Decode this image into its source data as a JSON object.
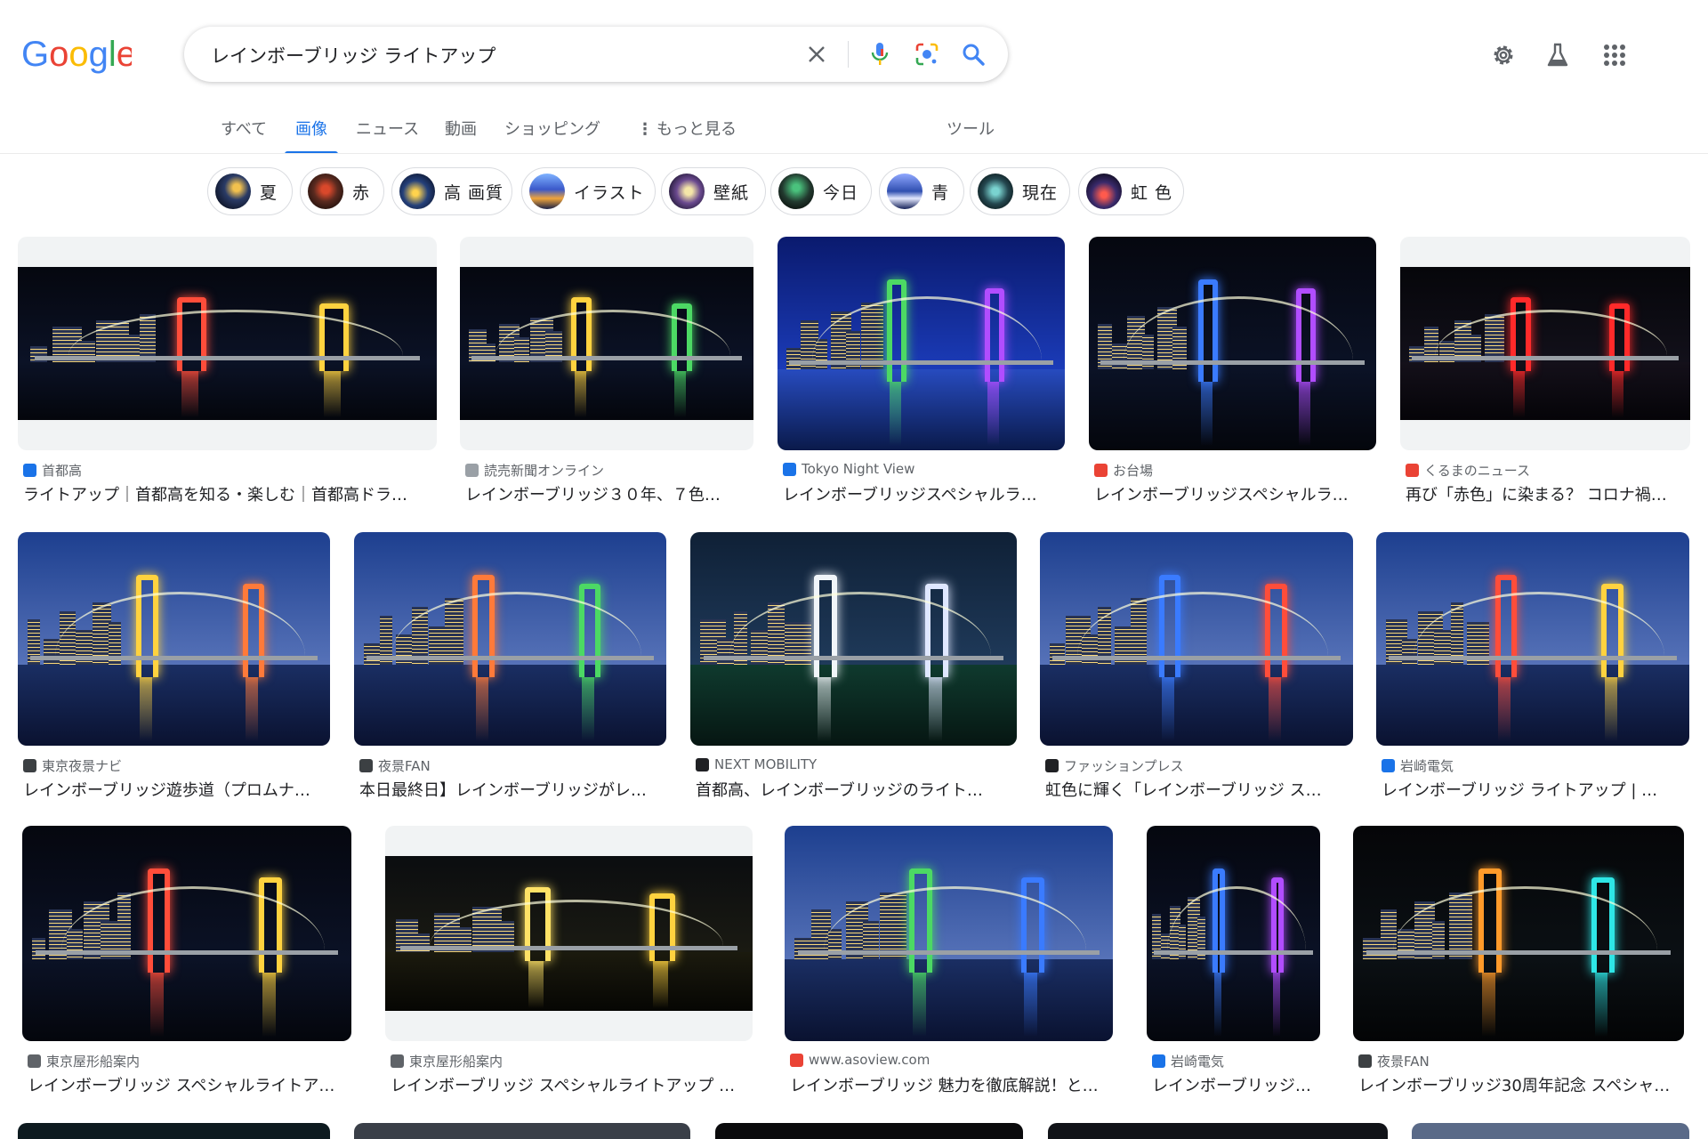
{
  "search": {
    "query": "レインボーブリッジ ライトアップ"
  },
  "brand": {
    "logo_letters": [
      "G",
      "o",
      "o",
      "g",
      "l",
      "e"
    ]
  },
  "tabs": [
    {
      "label": "すべて"
    },
    {
      "label": "画像"
    },
    {
      "label": "ニュース"
    },
    {
      "label": "動画"
    },
    {
      "label": "ショッピング"
    },
    {
      "label": "もっと見る"
    },
    {
      "label": "ツール"
    }
  ],
  "chips": [
    {
      "label": "夏"
    },
    {
      "label": "赤"
    },
    {
      "label": "高 画質"
    },
    {
      "label": "イラスト"
    },
    {
      "label": "壁紙"
    },
    {
      "label": "今日"
    },
    {
      "label": "青"
    },
    {
      "label": "現在"
    },
    {
      "label": "虹 色"
    }
  ],
  "results": [
    {
      "source": "首都高",
      "title": "ライトアップ｜首都高を知る・楽しむ｜首都高ドラ…",
      "fav_color": "#1a73e8",
      "scheme": "rainbow"
    },
    {
      "source": "読売新聞オンライン",
      "title": "レインボーブリッジ３０年、７色…",
      "fav_color": "#9aa0a6",
      "scheme": "rainbow"
    },
    {
      "source": "Tokyo Night View",
      "title": "レインボーブリッジスペシャルラ…",
      "fav_color": "#1a73e8",
      "scheme": "vivid"
    },
    {
      "source": "お台場",
      "title": "レインボーブリッジスペシャルラ…",
      "fav_color": "#ea4335",
      "scheme": "rainbow"
    },
    {
      "source": "くるまのニュース",
      "title": "再び「赤色」に染まる？ コロナ禍…",
      "fav_color": "#ea4335",
      "scheme": "red"
    },
    {
      "source": "東京夜景ナビ",
      "title": "レインボーブリッジ遊歩道（プロムナ…",
      "fav_color": "#3c4043",
      "scheme": "dusk"
    },
    {
      "source": "夜景FAN",
      "title": "本日最終日】レインボーブリッジがレ…",
      "fav_color": "#3c4043",
      "scheme": "dusk"
    },
    {
      "source": "NEXT MOBILITY",
      "title": "首都高、レインボーブリッジのライト…",
      "fav_color": "#202124",
      "scheme": "white"
    },
    {
      "source": "ファッションプレス",
      "title": "虹色に輝く「レインボーブリッジ ス…",
      "fav_color": "#202124",
      "scheme": "dusk"
    },
    {
      "source": "岩崎電気",
      "title": "レインボーブリッジ ライトアップ | …",
      "fav_color": "#1a73e8",
      "scheme": "dusk"
    },
    {
      "source": "東京屋形船案内",
      "title": "レインボーブリッジ スペシャルライトア…",
      "fav_color": "#5f6368",
      "scheme": "rainbow"
    },
    {
      "source": "東京屋形船案内",
      "title": "レインボーブリッジ スペシャルライトアップ …",
      "fav_color": "#5f6368",
      "scheme": "yellow"
    },
    {
      "source": "www.asoview.com",
      "title": "レインボーブリッジ 魅力を徹底解説！と…",
      "fav_color": "#ea4335",
      "scheme": "dusk"
    },
    {
      "source": "岩崎電気",
      "title": "レインボーブリッジ …",
      "fav_color": "#1a73e8",
      "scheme": "rainbow"
    },
    {
      "source": "夜景FAN",
      "title": "レインボーブリッジ30周年記念 スペシャ…",
      "fav_color": "#3c4043",
      "scheme": "cyan"
    }
  ]
}
